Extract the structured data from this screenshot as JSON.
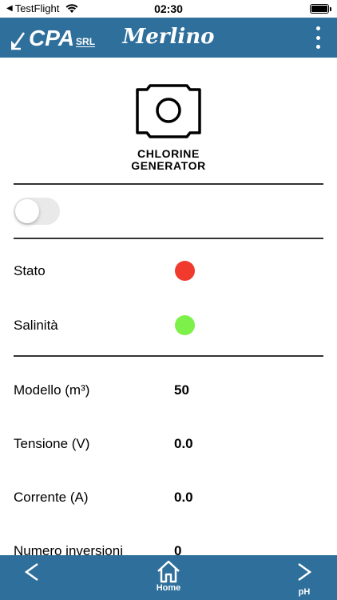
{
  "status_bar": {
    "back_app": "TestFlight",
    "time": "02:30"
  },
  "header": {
    "brand": "CPA",
    "brand_suffix": "SRL",
    "title": "Merlino",
    "menu_icon": "kebab-menu-icon"
  },
  "device": {
    "icon": "chlorine-generator-icon",
    "label_line1": "CHLORINE",
    "label_line2": "GENERATOR"
  },
  "toggle": {
    "state": "off"
  },
  "status_rows": [
    {
      "label": "Stato",
      "color": "#f03a2e"
    },
    {
      "label": "Salinità",
      "color": "#7ef04a"
    }
  ],
  "value_rows": [
    {
      "label": "Modello (m³)",
      "value": "50"
    },
    {
      "label": "Tensione (V)",
      "value": "0.0"
    },
    {
      "label": "Corrente (A)",
      "value": "0.0"
    },
    {
      "label": "Numero inversioni",
      "value": "0"
    }
  ],
  "bottom_nav": {
    "back_icon": "chevron-left-icon",
    "home_label": "Home",
    "home_icon": "home-icon",
    "next_label": "pH",
    "next_icon": "chevron-right-icon"
  },
  "colors": {
    "header_bg": "#2e6f9b",
    "status_error": "#f03a2e",
    "status_ok": "#7ef04a"
  }
}
